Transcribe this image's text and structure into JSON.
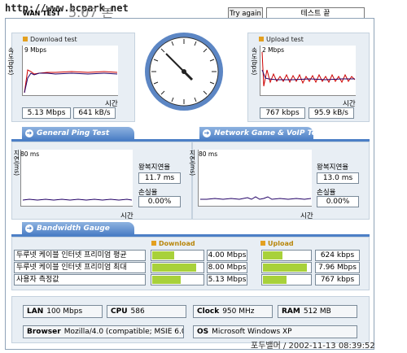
{
  "header": {
    "url_text": "http://www.bcpark.net",
    "tab": "WAN TEST",
    "version": "5.07 본",
    "try_again": "Try again",
    "status": "테스트 끝"
  },
  "download": {
    "title": "Download test",
    "scale": "9 Mbps",
    "ylabel": "속도(bps)",
    "xlabel": "시간",
    "mbps": "5.13 Mbps",
    "kbs": "641 kB/s"
  },
  "upload": {
    "title": "Upload test",
    "scale": "2 Mbps",
    "ylabel": "속도(bps)",
    "xlabel": "시간",
    "kbps": "767 kbps",
    "kbs": "95.9 kB/s"
  },
  "tabs": {
    "ping": "General Ping Test",
    "game": "Network Game & VoIP Test",
    "gauge": "Bandwidth Gauge"
  },
  "ping": {
    "scale": "80 ms",
    "ylabel": "지연(ms)",
    "xlabel": "시간",
    "rtt_label": "왕복지연율",
    "rtt": "11.7 ms",
    "loss_label": "손실율",
    "loss": "0.00%"
  },
  "game": {
    "scale": "80 ms",
    "ylabel": "지연(ms)",
    "xlabel": "시간",
    "rtt_label": "왕복지연율",
    "rtt": "13.0 ms",
    "loss_label": "손실율",
    "loss": "0.00%"
  },
  "gauge": {
    "download_head": "Download",
    "upload_head": "Upload",
    "rows": [
      {
        "label": "두루넷 케이블 인터넷 프리미엄 평균",
        "down": "4.00 Mbps",
        "down_frac": 0.42,
        "up": "624 kbps",
        "up_frac": 0.4
      },
      {
        "label": "두루넷 케이블 인터넷 프리미엄 최대",
        "down": "8.00 Mbps",
        "down_frac": 0.84,
        "up": "7.96 Mbps",
        "up_frac": 0.9
      },
      {
        "label": "사용자 측정값",
        "down": "5.13 Mbps",
        "down_frac": 0.54,
        "up": "767 kbps",
        "up_frac": 0.48
      }
    ]
  },
  "sys": {
    "lan_label": "LAN",
    "lan": "100 Mbps",
    "cpu_label": "CPU",
    "cpu": "586",
    "clock_label": "Clock",
    "clock": "950 MHz",
    "ram_label": "RAM",
    "ram": "512 MB",
    "browser_label": "Browser",
    "browser": "Mozilla/4.0 (compatible; MSIE 6.0",
    "os_label": "OS",
    "os": "Microsoft Windows XP"
  },
  "footer": "포두밸머 / 2002-11-13 08:39:52",
  "colors": {
    "tab": "#4c7fc6",
    "bar": "#a8d13a",
    "panel": "#e8eef4"
  }
}
